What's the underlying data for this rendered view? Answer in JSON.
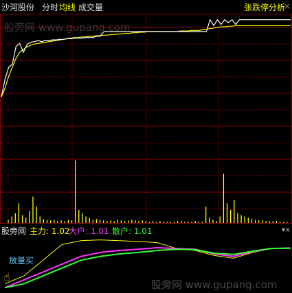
{
  "header": {
    "stock_name": "沙河股份",
    "tabs": [
      {
        "label": "分时"
      },
      {
        "label": "均线"
      },
      {
        "label": "成交量"
      }
    ],
    "analysis_label": "张跌停分析",
    "close_symbol": "×"
  },
  "watermark": "股旁网 www.gupang.com",
  "indicator": {
    "name": "股旁网",
    "main_label": "主力: 1.02",
    "big_label": "大户: 1.01",
    "retail_label": "散户: 1.01",
    "menu_symbol": "▾",
    "close_symbol": "×",
    "signal_text": "放量买"
  },
  "colors": {
    "price_line": "#ffffff",
    "avg_line": "#ffff00",
    "volume": "#ffff00",
    "grid": "#8b0000",
    "main_force": "#ffff00",
    "big_holder": "#ff33ff",
    "retail": "#33ff33",
    "signal": "#66ccff"
  },
  "chart_data": [
    {
      "type": "line",
      "series": [
        {
          "values": [
            0.0,
            0.3,
            0.5,
            0.55,
            0.85,
            0.9,
            0.75,
            0.88,
            0.92,
            0.93,
            0.95,
            0.93,
            0.95,
            0.95,
            0.96,
            0.96,
            0.97,
            0.97,
            0.98,
            0.98,
            0.99,
            0.99,
            0.99,
            1.0,
            1.0,
            1.0,
            1.02,
            1.02,
            1.1,
            1.1,
            1.1,
            1.1,
            1.1,
            1.1,
            1.1,
            1.1,
            1.1,
            1.1,
            1.1,
            1.1,
            1.1,
            1.1,
            1.1,
            1.1,
            1.1,
            1.1,
            1.1,
            1.1,
            1.1,
            1.1,
            1.1,
            1.1,
            1.1,
            1.1,
            1.1,
            1.1,
            1.1,
            1.3,
            1.2,
            1.3,
            1.22,
            1.3,
            1.25,
            1.3,
            1.22,
            1.3,
            1.3,
            1.3,
            1.3,
            1.3,
            1.3,
            1.3,
            1.3,
            1.3,
            1.3,
            1.3,
            1.3,
            1.3,
            1.3,
            1.3
          ]
        },
        {
          "values": [
            0.0,
            0.15,
            0.35,
            0.5,
            0.65,
            0.75,
            0.8,
            0.84,
            0.87,
            0.89,
            0.9,
            0.91,
            0.92,
            0.93,
            0.94,
            0.95,
            0.96,
            0.97,
            0.98,
            0.99,
            1.0,
            1.0,
            1.01,
            1.01,
            1.02,
            1.02,
            1.03,
            1.03,
            1.04,
            1.04,
            1.05,
            1.05,
            1.06,
            1.06,
            1.07,
            1.07,
            1.08,
            1.08,
            1.09,
            1.09,
            1.1,
            1.1,
            1.1,
            1.1,
            1.1,
            1.1,
            1.1,
            1.1,
            1.1,
            1.11,
            1.11,
            1.11,
            1.12,
            1.12,
            1.12,
            1.13,
            1.14,
            1.15,
            1.16,
            1.17,
            1.18,
            1.18,
            1.19,
            1.19,
            1.2,
            1.2,
            1.2,
            1.2,
            1.2,
            1.2,
            1.2,
            1.2,
            1.2,
            1.2,
            1.2,
            1.2,
            1.2,
            1.2,
            1.2,
            1.2
          ]
        }
      ]
    },
    {
      "type": "bar",
      "values": [
        0.05,
        0.1,
        0.15,
        0.3,
        0.12,
        0.08,
        0.18,
        0.4,
        0.25,
        0.1,
        0.06,
        0.05,
        0.04,
        0.05,
        0.03,
        0.04,
        0.03,
        0.05,
        0.04,
        0.95,
        0.2,
        0.15,
        0.1,
        0.08,
        0.05,
        0.06,
        0.05,
        0.04,
        0.03,
        0.04,
        0.03,
        0.05,
        0.04,
        0.03,
        0.04,
        0.05,
        0.04,
        0.03,
        0.04,
        0.03,
        0.02,
        0.03,
        0.02,
        0.03,
        0.02,
        0.02,
        0.02,
        0.02,
        0.03,
        0.03,
        0.02,
        0.02,
        0.02,
        0.03,
        0.02,
        0.02,
        0.25,
        0.08,
        0.05,
        0.03,
        0.1,
        0.75,
        0.3,
        0.2,
        0.35,
        0.15,
        0.12,
        0.1,
        0.08,
        0.06,
        0.05,
        0.04,
        0.04,
        0.03,
        0.03,
        0.03,
        0.03,
        0.02,
        0.02,
        0.02
      ]
    },
    {
      "type": "line",
      "series": [
        {
          "values": [
            0.1,
            0.3,
            0.7,
            1.1,
            1.2,
            1.22,
            1.2,
            1.18,
            1.15,
            1.0,
            0.95,
            0.82,
            0.75,
            0.9,
            1.0,
            1.02
          ]
        },
        {
          "values": [
            0.0,
            0.2,
            0.4,
            0.6,
            0.8,
            0.9,
            0.95,
            0.98,
            1.02,
            1.0,
            0.98,
            0.86,
            0.8,
            0.92,
            1.0,
            1.01
          ]
        },
        {
          "values": [
            0.0,
            0.1,
            0.3,
            0.5,
            0.7,
            0.8,
            0.86,
            0.9,
            0.95,
            0.98,
            0.97,
            0.88,
            0.85,
            0.93,
            1.0,
            1.01
          ]
        }
      ]
    }
  ]
}
